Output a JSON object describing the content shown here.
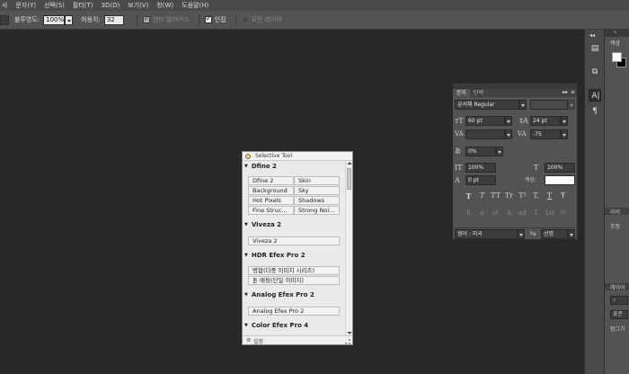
{
  "menu": [
    "사",
    "문자(Y)",
    "선택(S)",
    "필터(T)",
    "3D(D)",
    "보기(V)",
    "창(W)",
    "도움말(H)"
  ],
  "options": {
    "opacity_label": "불투명도:",
    "opacity_value": "100%",
    "tolerance_label": "허용치:",
    "tolerance_value": "32",
    "antialias_label": "앤티 앨리어스",
    "contiguous_label": "인접",
    "all_layers_label": "모든 레이어"
  },
  "colors": {
    "foreground": "#ffffff",
    "background": "#000000",
    "canvas": "#282828"
  },
  "dock": {
    "color_title": "색상",
    "sec1": "라이",
    "sec2": "조정",
    "sec3": "레이어",
    "sec4_btn": "표준",
    "sec5": "잠그기",
    "search_icon": "search-icon"
  },
  "character": {
    "tab_character": "문자",
    "tab_paragraph": "단락",
    "font_family": "궁서체 Regular",
    "font_style": "-",
    "font_size": "60 pt",
    "leading": "24 pt",
    "kerning": "",
    "tracking": "-75",
    "tsume": "0%",
    "vertical_scale": "100%",
    "horizontal_scale": "100%",
    "baseline_shift": "0 pt",
    "color_label": "색상:",
    "type_styles": [
      "T",
      "T",
      "TT",
      "Tr",
      "T¹",
      "T,",
      "T",
      "Ŧ"
    ],
    "opentype": [
      "fi",
      "ơ",
      "st",
      "A",
      "ad",
      "T",
      "1st",
      "½"
    ],
    "language": "영어 : 미국",
    "aa_label": "ªa",
    "aa_method": "선명"
  },
  "selective": {
    "title": "Selective Tool",
    "groups": [
      {
        "name": "Dfine 2",
        "buttons": [
          "Dfine 2",
          "Skin",
          "Background",
          "Sky",
          "Hot Pixels",
          "Shadows",
          "Fine Struc...",
          "Strong Noi..."
        ]
      },
      {
        "name": "Viveza 2",
        "buttons": [
          "Viveza 2"
        ]
      },
      {
        "name": "HDR Efex Pro 2",
        "buttons": [
          "병합(다중 이미지 시리즈)",
          "톤 매핑(단일 이미지)"
        ]
      },
      {
        "name": "Analog Efex Pro 2",
        "buttons": [
          "Analog Efex Pro 2"
        ]
      },
      {
        "name": "Color Efex Pro 4",
        "buttons": []
      }
    ],
    "footer": "설정"
  }
}
